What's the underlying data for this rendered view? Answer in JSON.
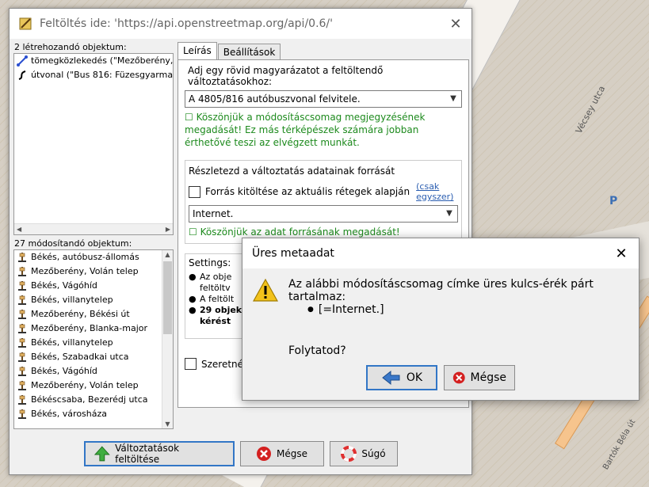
{
  "map": {
    "street1": "Vécsey utca",
    "street2": "Bartók Béla út",
    "parking": "P"
  },
  "window": {
    "title": "Feltöltés ide: 'https://api.openstreetmap.org/api/0.6/'",
    "close": "✕"
  },
  "left": {
    "created_label": "2 létrehozandó objektum:",
    "created_items": [
      "tömegközlekedés (\"Mezőberény, Volá",
      "útvonal (\"Bus 816: Füzesgyarmat, vá"
    ],
    "modified_label": "27 módosítandó objektum:",
    "modified_items": [
      "Békés, autóbusz-állomás",
      "Mezőberény, Volán telep",
      "Békés, Vágóhíd",
      "Békés, villanytelep",
      "Mezőberény, Békési út",
      "Mezőberény, Blanka-major",
      "Békés, villanytelep",
      "Békés, Szabadkai utca",
      "Békés, Vágóhíd",
      "Mezőberény, Volán telep",
      "Békéscsaba, Bezerédj utca",
      "Békés, városháza"
    ]
  },
  "tabs": {
    "desc": "Leírás",
    "settings": "Beállítások"
  },
  "description": {
    "label": "Adj egy rövid magyarázatot a feltöltendő változtatásokhoz:",
    "value": "A 4805/816 autóbuszvonal felvitele.",
    "thanks": "☐ Köszönjük a módosításcsomag megjegyzésének megadását! Ez más térképészek számára jobban érthetővé teszi az elvégzett munkát."
  },
  "source": {
    "group_title": "Részletezd a változtatás adatainak forrását",
    "checkbox_label": "Forrás kitöltése az aktuális rétegek alapján",
    "link1": "(csak",
    "link2": "egyszer)",
    "value": "Internet.",
    "thanks": "☐ Köszönjük az adat forrásának megadását!"
  },
  "settings": {
    "label": "Settings:",
    "b1a": "Az obje",
    "b1b": "feltöltv",
    "b2": "A feltölt",
    "b3a": "29 objek",
    "b3b": "kérést"
  },
  "bottom_check": "Szeretnél",
  "buttons": {
    "upload": "Változtatások feltöltése",
    "cancel": "Mégse",
    "help": "Súgó"
  },
  "dialog": {
    "title": "Üres metaadat",
    "close": "✕",
    "message": "Az alábbi módosításcsomag címke üres kulcs-érék párt tartalmaz:",
    "item": "[=Internet.]",
    "question": "Folytatod?",
    "ok": "OK",
    "cancel": "Mégse"
  }
}
